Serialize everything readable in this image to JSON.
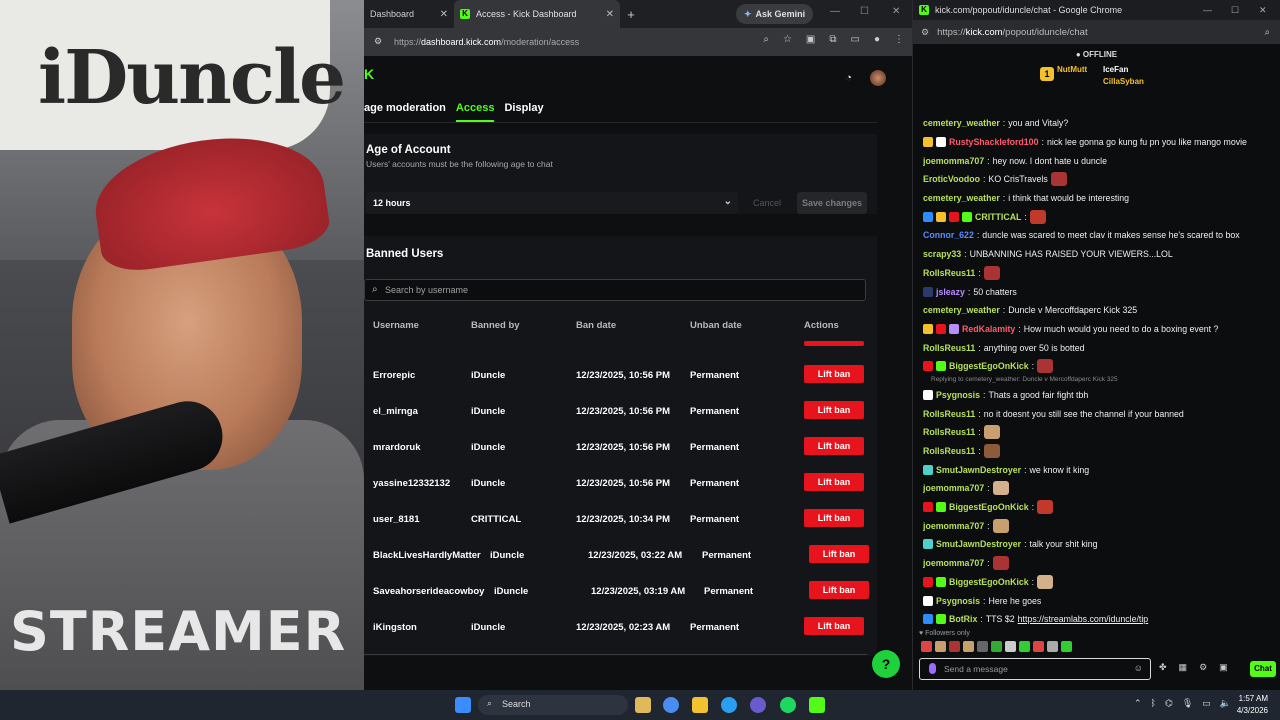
{
  "webcam": {
    "sign_text": "iDuncle",
    "hoodie_text": "STREAMER"
  },
  "left_browser": {
    "tabs": [
      {
        "label": "Dashboard",
        "active": false
      },
      {
        "label": "Access - Kick Dashboard",
        "active": true
      }
    ],
    "ask_gemini": "Ask Gemini",
    "url_prefix": "https://",
    "url_host": "dashboard.kick.com",
    "url_path": "/moderation/access"
  },
  "dashboard": {
    "subtabs": [
      {
        "label": "age moderation",
        "active": false
      },
      {
        "label": "Access",
        "active": true
      },
      {
        "label": "Display",
        "active": false
      }
    ],
    "age_of_account": {
      "title": "Age of Account",
      "subtitle": "Users' accounts must be the following age to chat",
      "selected": "12 hours",
      "cancel_label": "Cancel",
      "save_label": "Save changes"
    },
    "banned_users": {
      "title": "Banned Users",
      "search_placeholder": "Search by username",
      "columns": [
        "Username",
        "Banned by",
        "Ban date",
        "Unban date",
        "Actions"
      ],
      "rows": [
        {
          "username": "Errorepic",
          "banned_by": "iDuncle",
          "ban_date": "12/23/2025, 10:56 PM",
          "unban_date": "Permanent",
          "action": "Lift ban"
        },
        {
          "username": "el_mirnga",
          "banned_by": "iDuncle",
          "ban_date": "12/23/2025, 10:56 PM",
          "unban_date": "Permanent",
          "action": "Lift ban"
        },
        {
          "username": "mrardoruk",
          "banned_by": "iDuncle",
          "ban_date": "12/23/2025, 10:56 PM",
          "unban_date": "Permanent",
          "action": "Lift ban"
        },
        {
          "username": "yassine12332132",
          "banned_by": "iDuncle",
          "ban_date": "12/23/2025, 10:56 PM",
          "unban_date": "Permanent",
          "action": "Lift ban"
        },
        {
          "username": "user_8181",
          "banned_by": "CRITTICAL",
          "ban_date": "12/23/2025, 10:34 PM",
          "unban_date": "Permanent",
          "action": "Lift ban"
        },
        {
          "username": "BlackLivesHardlyMatter",
          "banned_by": "iDuncle",
          "ban_date": "12/23/2025, 03:22 AM",
          "unban_date": "Permanent",
          "action": "Lift ban"
        },
        {
          "username": "Saveahorserideacowboy",
          "banned_by": "iDuncle",
          "ban_date": "12/23/2025, 03:19 AM",
          "unban_date": "Permanent",
          "action": "Lift ban"
        },
        {
          "username": "iKingston",
          "banned_by": "iDuncle",
          "ban_date": "12/23/2025, 02:23 AM",
          "unban_date": "Permanent",
          "action": "Lift ban"
        }
      ]
    }
  },
  "chat_window": {
    "title": "kick.com/popout/iduncle/chat - Google Chrome",
    "url_prefix": "https://",
    "url_host": "kick.com",
    "url_path": "/popout/iduncle/chat",
    "status": "OFFLINE",
    "pinned": {
      "rank": "1",
      "first": "NutMutt",
      "second": "IceFan",
      "third": "CillaSyban"
    },
    "messages": [
      {
        "user": "cemetery_weather",
        "color": "#b7e05a",
        "text": "you and Vitaly?",
        "badges": []
      },
      {
        "user": "RustyShackleford100",
        "color": "#ff5a6e",
        "text": "nick lee gonna go kung fu pn you like mango movie",
        "badges": [
          "#f5c12b",
          "#ffffff"
        ]
      },
      {
        "user": "joemomma707",
        "color": "#b7e05a",
        "text": "hey now. I dont hate u duncle",
        "badges": []
      },
      {
        "user": "EroticVoodoo",
        "color": "#b7e05a",
        "text": "KO CrisTravels",
        "badges": []
      },
      {
        "user": "cemetery_weather",
        "color": "#b7e05a",
        "text": "i think that would be interesting",
        "badges": []
      },
      {
        "user": "CRITTICAL",
        "color": "#b7e05a",
        "text": "",
        "badges": [
          "#2f8cff",
          "#f5c12b",
          "#e8141d",
          "#53fc18"
        ]
      },
      {
        "user": "Connor_622",
        "color": "#5a8cff",
        "text": "duncle was scared to meet clav it makes sense he's scared to box",
        "badges": []
      },
      {
        "user": "scrapy33",
        "color": "#b7e05a",
        "text": "UNBANNING HAS RAISED YOUR VIEWERS...LOL",
        "badges": []
      },
      {
        "user": "RollsReus11",
        "color": "#b7e05a",
        "text": "",
        "badges": []
      },
      {
        "user": "jsleazy",
        "color": "#b98cff",
        "text": "50 chatters",
        "badges": [
          "#2a3a6a"
        ]
      },
      {
        "user": "cemetery_weather",
        "color": "#b7e05a",
        "text": "Duncle v Mercoffdaperc Kick 325",
        "badges": []
      },
      {
        "user": "RedKalamity",
        "color": "#ff5a6e",
        "text": "How much would you need to do a boxing event ?",
        "badges": [
          "#f5c12b",
          "#e8141d",
          "#b98cff"
        ]
      },
      {
        "user": "RollsReus11",
        "color": "#b7e05a",
        "text": "anything over 50 is botted",
        "badges": []
      },
      {
        "user": "BiggestEgoOnKick",
        "color": "#b7e05a",
        "text": "",
        "badges": [
          "#e8141d",
          "#53fc18"
        ]
      },
      {
        "user": "Psygnosis",
        "color": "#b7e05a",
        "text": "Thats a good fair fight tbh",
        "badges": [
          "#ffffff"
        ],
        "reply": "Replying to cemetery_weather: Duncle v Mercoffdaperc Kick 325"
      },
      {
        "user": "RollsReus11",
        "color": "#b7e05a",
        "text": "no it doesnt you still see the channel if your banned",
        "badges": []
      },
      {
        "user": "RollsReus11",
        "color": "#b7e05a",
        "text": "",
        "badges": []
      },
      {
        "user": "RollsReus11",
        "color": "#b7e05a",
        "text": "",
        "badges": []
      },
      {
        "user": "SmutJawnDestroyer",
        "color": "#b7e05a",
        "text": "we know it king",
        "badges": [
          "#4fd0c8"
        ]
      },
      {
        "user": "joemomma707",
        "color": "#b7e05a",
        "text": "",
        "badges": []
      },
      {
        "user": "BiggestEgoOnKick",
        "color": "#b7e05a",
        "text": "",
        "badges": [
          "#e8141d",
          "#53fc18"
        ]
      },
      {
        "user": "joemomma707",
        "color": "#b7e05a",
        "text": "",
        "badges": []
      },
      {
        "user": "SmutJawnDestroyer",
        "color": "#b7e05a",
        "text": "talk your shit king",
        "badges": [
          "#4fd0c8"
        ]
      },
      {
        "user": "joemomma707",
        "color": "#b7e05a",
        "text": "",
        "badges": []
      },
      {
        "user": "BiggestEgoOnKick",
        "color": "#b7e05a",
        "text": "",
        "badges": [
          "#e8141d",
          "#53fc18"
        ]
      },
      {
        "user": "Psygnosis",
        "color": "#b7e05a",
        "text": "Here he goes",
        "badges": [
          "#ffffff"
        ]
      },
      {
        "user": "BotRix",
        "color": "#b7e05a",
        "text": "TTS $2 ",
        "link": "https://streamlabs.com/iduncle/tip",
        "badges": [
          "#2f8cff",
          "#53fc18"
        ]
      }
    ],
    "followers_only": "Followers only",
    "input_placeholder": "Send a message",
    "chat_button": "Chat"
  },
  "taskbar": {
    "search_label": "Search",
    "time": "1:57 AM",
    "date": "4/3/2026"
  }
}
